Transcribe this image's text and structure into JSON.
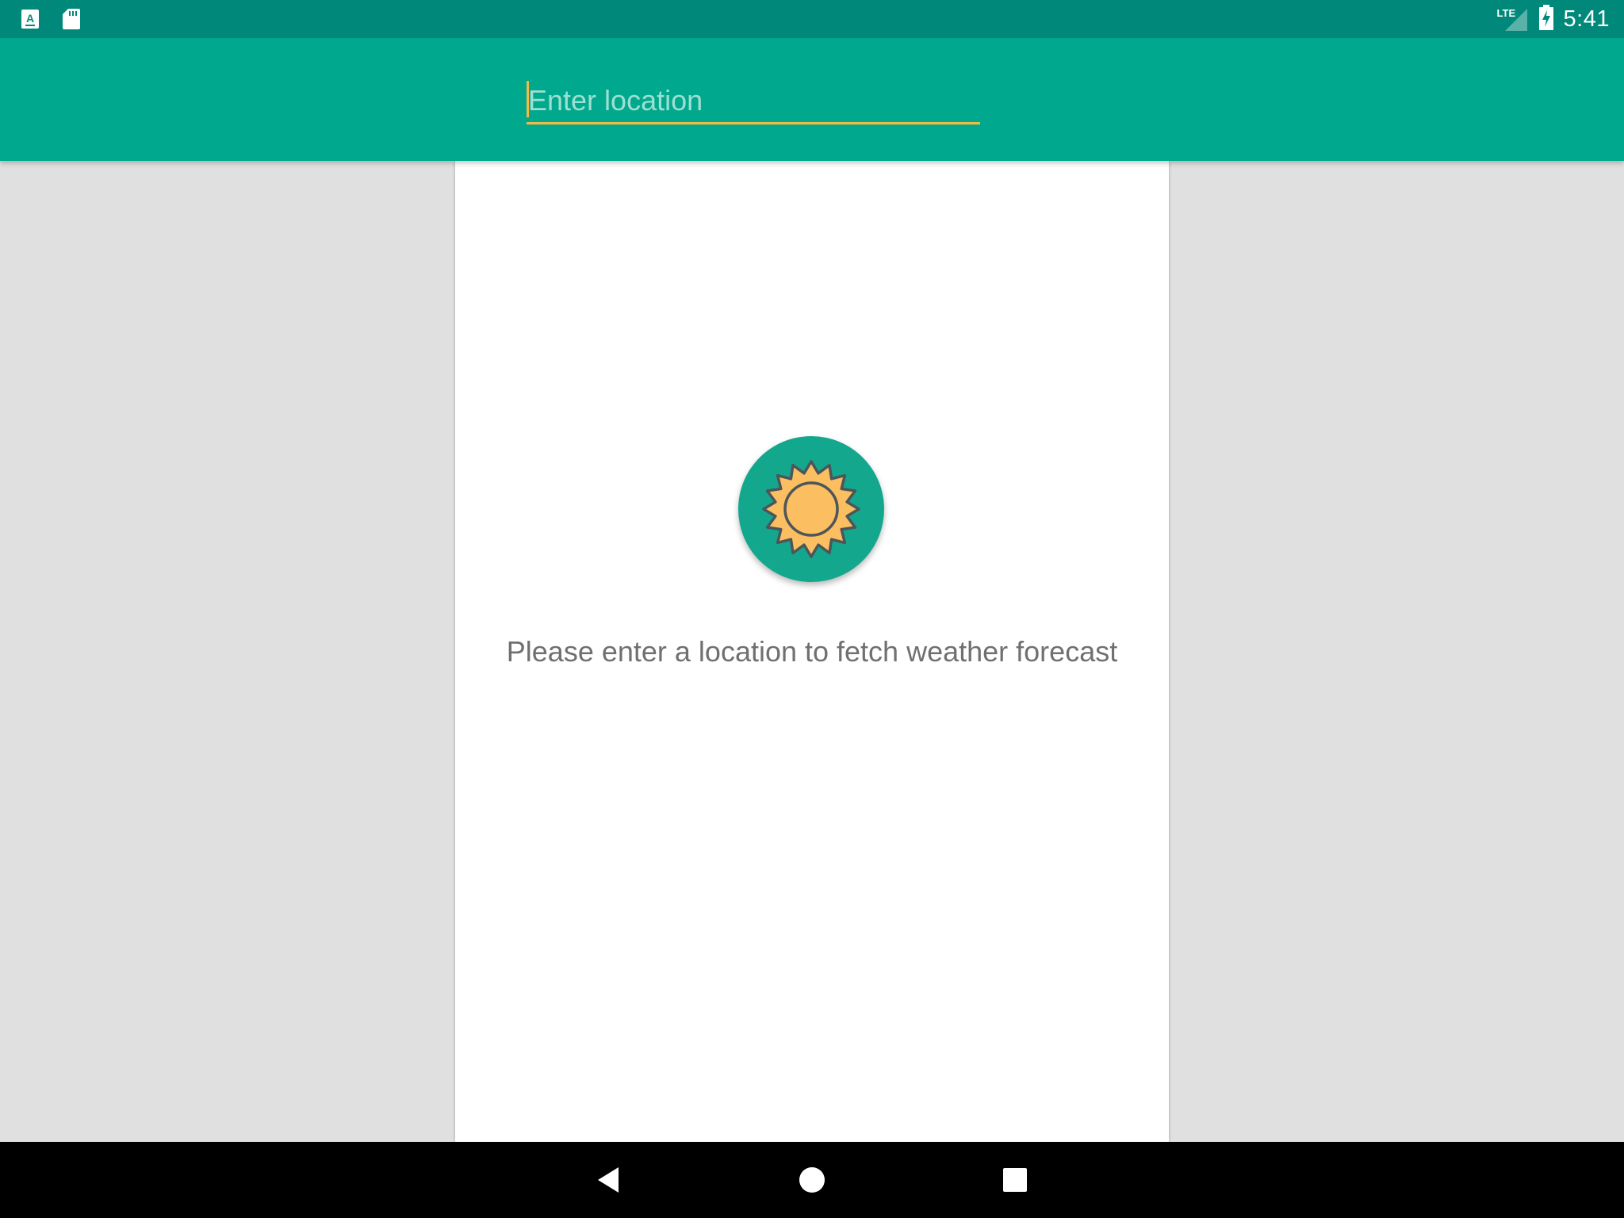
{
  "status_bar": {
    "left_icons": [
      "keyboard-a-icon",
      "sd-card-icon"
    ],
    "network": "LTE",
    "icons": [
      "lte-signal-icon",
      "battery-charging-icon"
    ],
    "time": "5:41"
  },
  "app_bar": {
    "search": {
      "placeholder": "Enter location",
      "value": ""
    }
  },
  "main": {
    "logo_icon": "sun-icon",
    "message": "Please enter a location to fetch weather forecast"
  },
  "nav_bar": {
    "buttons": [
      "back-icon",
      "home-icon",
      "recents-icon"
    ]
  },
  "colors": {
    "status_bar": "#00897b",
    "app_bar": "#00a98d",
    "accent": "#f4b943",
    "background": "#e0e0e0",
    "card": "#ffffff",
    "logo_circle": "#13a88e",
    "sun": "#fbbf62",
    "message_text": "#707070"
  }
}
